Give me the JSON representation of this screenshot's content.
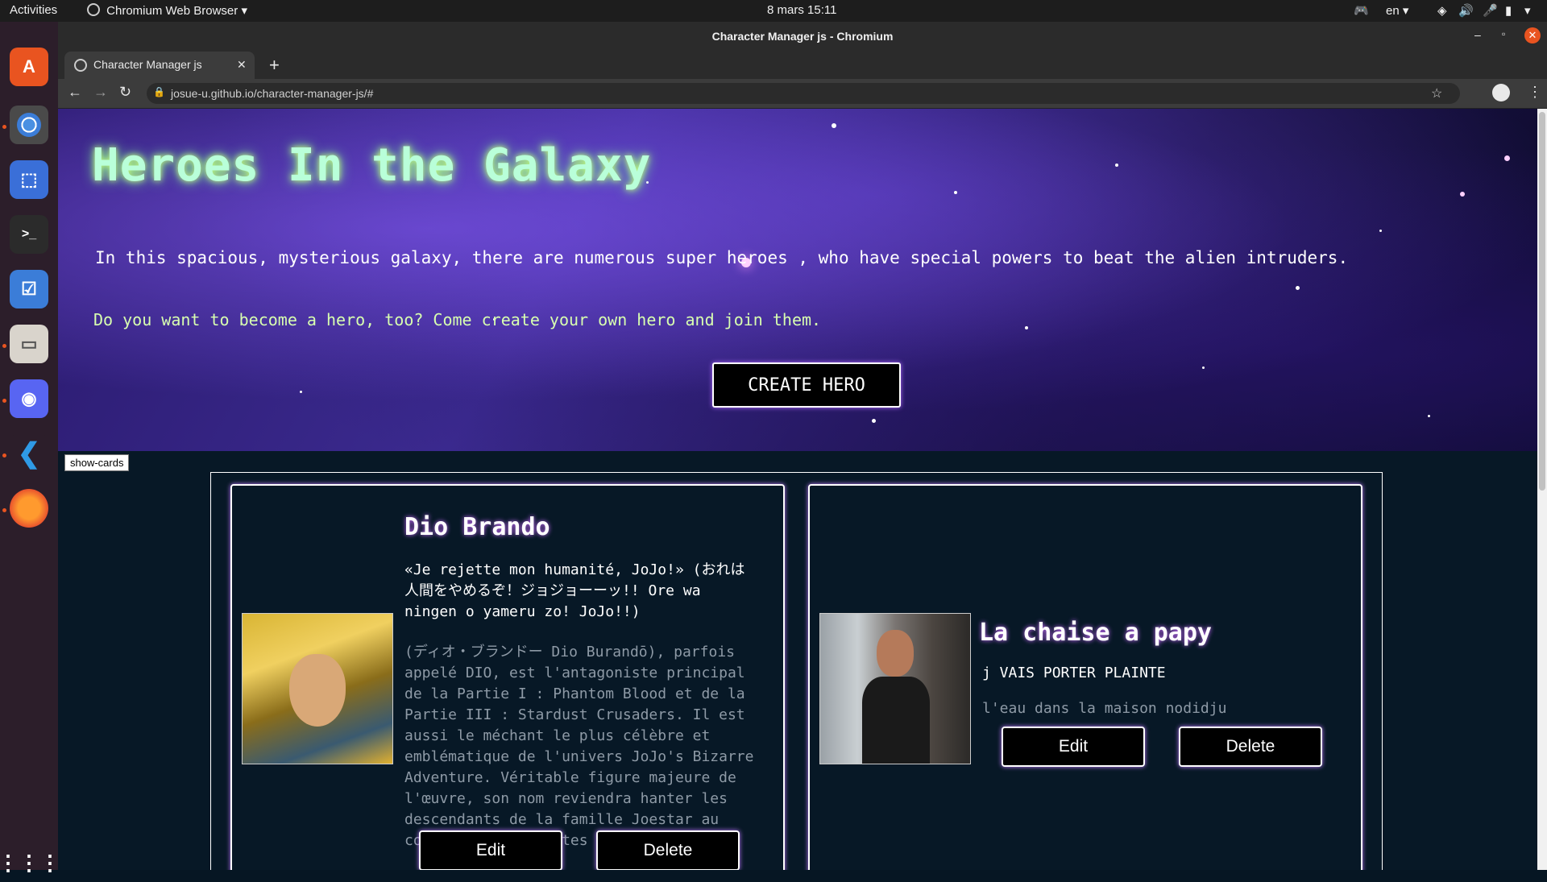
{
  "system": {
    "activities": "Activities",
    "app_name": "Chromium Web Browser",
    "clock": "8 mars  15:11",
    "language": "en"
  },
  "browser": {
    "window_title": "Character Manager js - Chromium",
    "tab_title": "Character Manager js",
    "url": "josue-u.github.io/character-manager-js/#"
  },
  "banner": {
    "title": "Heroes In the Galaxy",
    "intro1": "In this spacious, mysterious galaxy, there are numerous super heroes , who have special powers to beat the alien intruders.",
    "intro2": "Do you want to become a hero, too? Come create your own hero and join them.",
    "create_button": "CREATE HERO"
  },
  "tooltip": "show-cards",
  "cards": [
    {
      "name": "Dio Brando",
      "subtitle": "«Je rejette mon humanité, JoJo!» (おれは人間をやめるぞ！ジョジョーーッ!! Ore wa ningen o yameru zo! JoJo!!)",
      "description": "(ディオ・ブランドー Dio Burandō), parfois appelé DIO, est l'antagoniste principal de la Partie I : Phantom Blood et de la Partie III : Stardust Crusaders. Il est aussi le méchant le plus célèbre et emblématique de l'univers JoJo's Bizarre Adventure. Véritable figure majeure de l'œuvre, son nom reviendra hanter les descendants de la famille Joestar au cours des différentes parties.",
      "edit": "Edit",
      "delete": "Delete"
    },
    {
      "name": "La chaise a papy",
      "subtitle": "j VAIS PORTER PLAINTE",
      "description": "l'eau dans la maison nodidju",
      "edit": "Edit",
      "delete": "Delete"
    }
  ],
  "colors": {
    "title_glow": "#b9ffd9",
    "card_glow": "#c07cff",
    "page_bg": "#071826"
  }
}
